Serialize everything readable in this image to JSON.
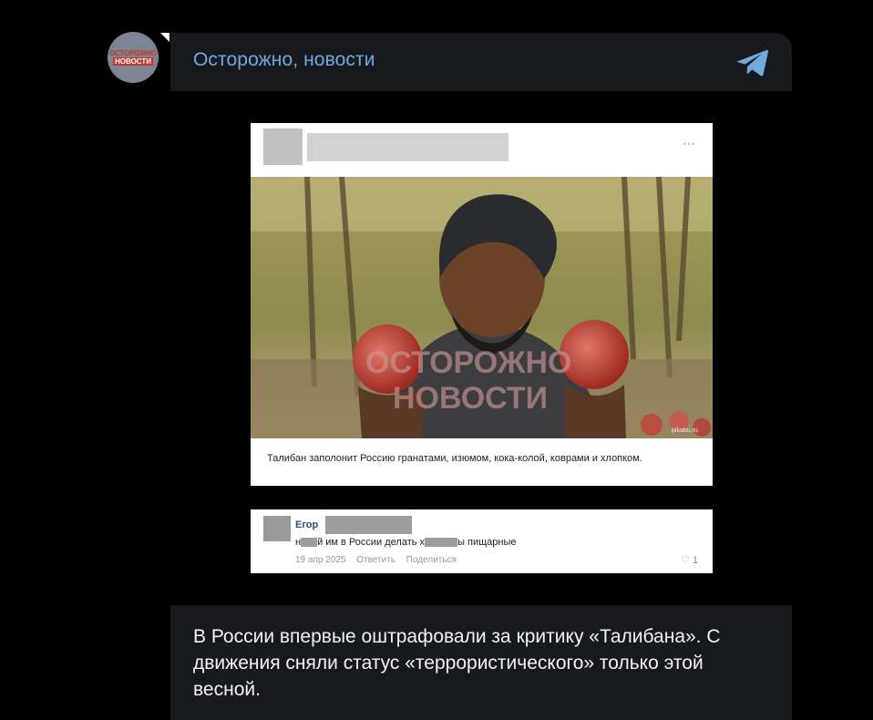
{
  "channel": {
    "name": "Осторожно, новости",
    "avatar_line1": "ОСТОРОЖНО",
    "avatar_line2": "НОВОСТИ",
    "accent": "#6fa9de"
  },
  "post": {
    "more_icon": "⋯",
    "photo_watermark_line1": "ОСТОРОЖНО",
    "photo_watermark_line2": "НОВОСТИ",
    "photo_credit": "pikabu.ru",
    "caption": "Талибан заполонит Россию гранатами, изюмом, кока-колой, коврами и хлопком."
  },
  "comment": {
    "author": "Егор",
    "text_part1": "н",
    "text_part2": "й им в России делать х",
    "text_part3": "ы пищарные",
    "date": "19 апр 2025",
    "reply": "Ответить",
    "share": "Поделиться",
    "like_icon": "♡",
    "likes": "1"
  },
  "message": {
    "text": "В России впервые оштрафовали за критику «Талибана». С движения сняли статус «террористического» только этой весной."
  }
}
